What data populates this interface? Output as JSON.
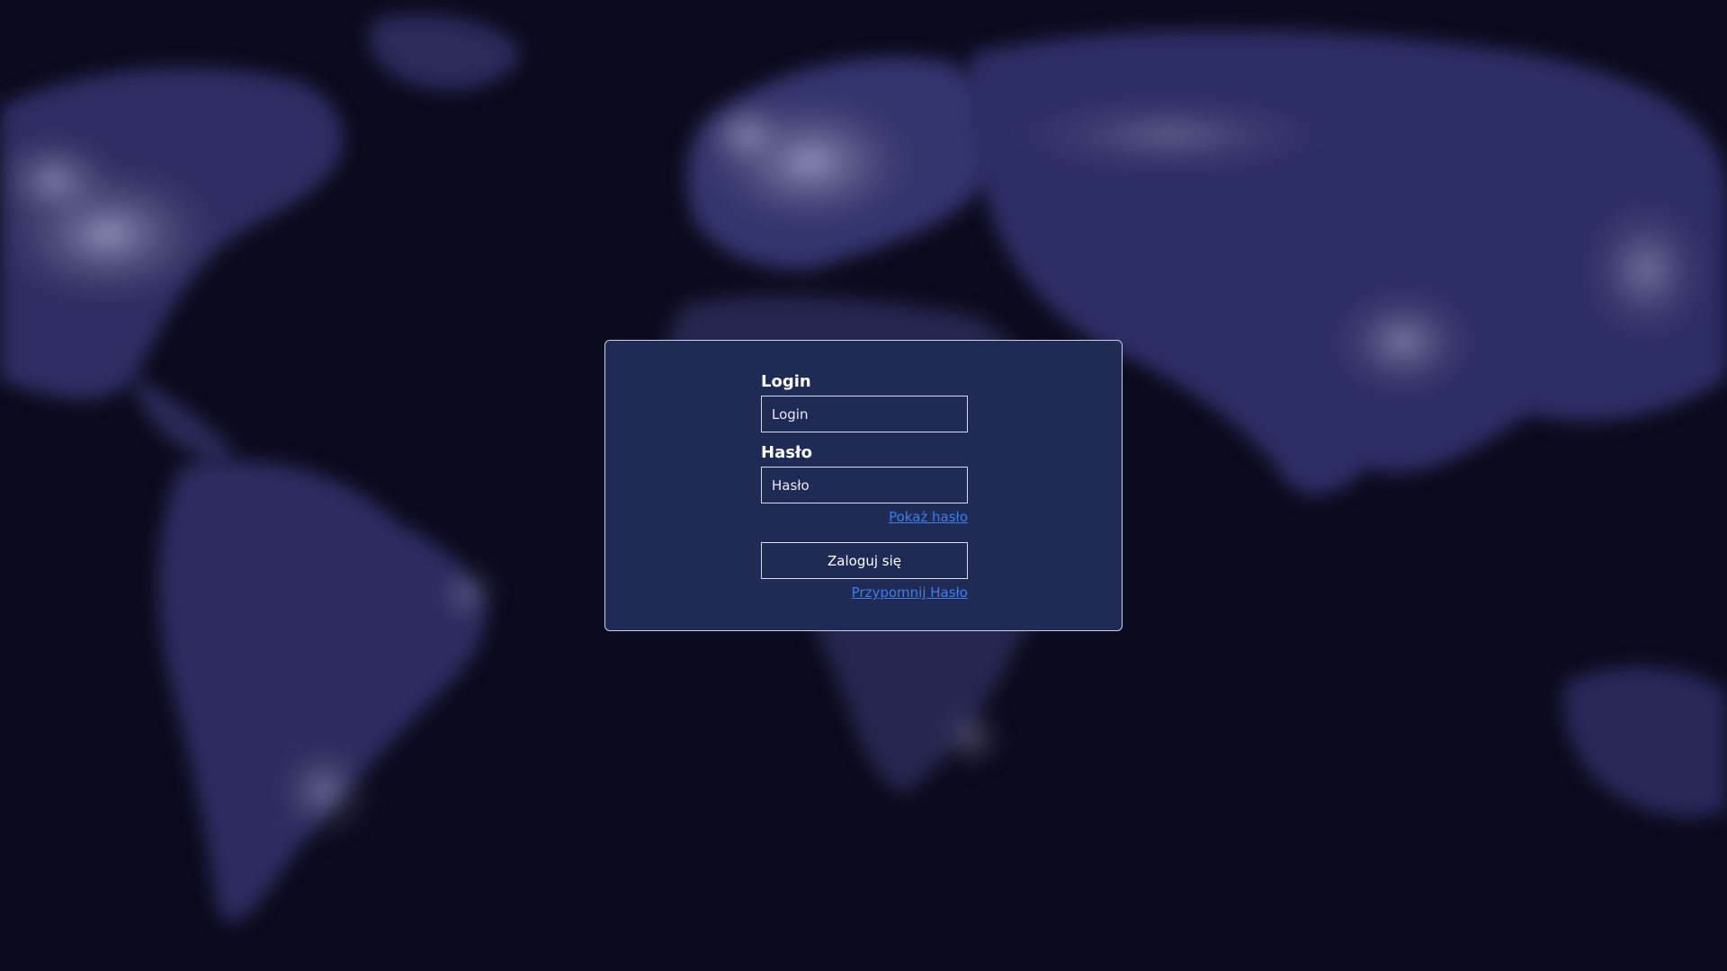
{
  "login_form": {
    "login_label": "Login",
    "login_placeholder": "Login",
    "password_label": "Hasło",
    "password_placeholder": "Hasło",
    "show_password_link": "Pokaż hasło",
    "submit_label": "Zaloguj się",
    "remind_password_link": "Przypomnij Hasło"
  },
  "colors": {
    "card_background": "#1f2a55",
    "link": "#3f7ee8",
    "page_background": "#0b0b1f"
  }
}
